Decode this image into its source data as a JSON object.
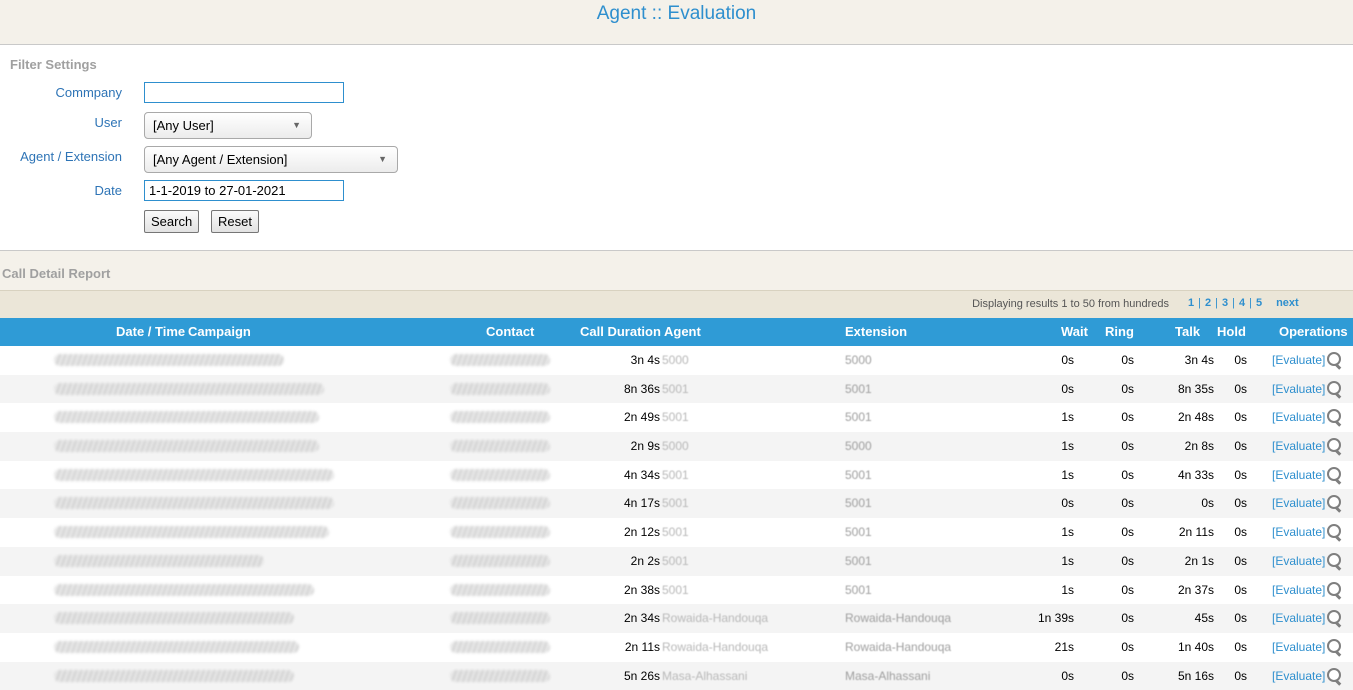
{
  "title": "Agent :: Evaluation",
  "filter": {
    "heading": "Filter Settings",
    "company_label": "Commpany",
    "company_value": "",
    "user_label": "User",
    "user_selected": "[Any User]",
    "agent_label": "Agent / Extension",
    "agent_selected": "[Any Agent / Extension]",
    "date_label": "Date",
    "date_value": "1-1-2019 to 27-01-2021",
    "search_label": "Search",
    "reset_label": "Reset"
  },
  "report": {
    "heading": "Call Detail Report",
    "pager_text": "Displaying results 1 to 50 from hundreds",
    "pages": [
      "1",
      "2",
      "3",
      "4",
      "5"
    ],
    "next_label": "next",
    "columns": {
      "datetime": "Date / Time",
      "campaign": "Campaign",
      "contact": "Contact",
      "duration": "Call Duration",
      "agent": "Agent",
      "extension": "Extension",
      "wait": "Wait",
      "ring": "Ring",
      "talk": "Talk",
      "hold": "Hold",
      "operations": "Operations"
    },
    "evaluate_label": "[Evaluate]",
    "rows": [
      {
        "duration": "3n 4s",
        "agent": "5000",
        "extension": "5000",
        "wait": "0s",
        "ring": "0s",
        "talk": "3n 4s",
        "hold": "0s"
      },
      {
        "duration": "8n 36s",
        "agent": "5001",
        "extension": "5001",
        "wait": "0s",
        "ring": "0s",
        "talk": "8n 35s",
        "hold": "0s"
      },
      {
        "duration": "2n 49s",
        "agent": "5001",
        "extension": "5001",
        "wait": "1s",
        "ring": "0s",
        "talk": "2n 48s",
        "hold": "0s"
      },
      {
        "duration": "2n 9s",
        "agent": "5000",
        "extension": "5000",
        "wait": "1s",
        "ring": "0s",
        "talk": "2n 8s",
        "hold": "0s"
      },
      {
        "duration": "4n 34s",
        "agent": "5001",
        "extension": "5001",
        "wait": "1s",
        "ring": "0s",
        "talk": "4n 33s",
        "hold": "0s"
      },
      {
        "duration": "4n 17s",
        "agent": "5001",
        "extension": "5001",
        "wait": "0s",
        "ring": "0s",
        "talk": "0s",
        "hold": "0s"
      },
      {
        "duration": "2n 12s",
        "agent": "5001",
        "extension": "5001",
        "wait": "1s",
        "ring": "0s",
        "talk": "2n 11s",
        "hold": "0s"
      },
      {
        "duration": "2n 2s",
        "agent": "5001",
        "extension": "5001",
        "wait": "1s",
        "ring": "0s",
        "talk": "2n 1s",
        "hold": "0s"
      },
      {
        "duration": "2n 38s",
        "agent": "5001",
        "extension": "5001",
        "wait": "1s",
        "ring": "0s",
        "talk": "2n 37s",
        "hold": "0s"
      },
      {
        "duration": "2n 34s",
        "agent": "Rowaida-Handouqa",
        "extension": "Rowaida-Handouqa",
        "wait": "1n 39s",
        "ring": "0s",
        "talk": "45s",
        "hold": "0s"
      },
      {
        "duration": "2n 11s",
        "agent": "Rowaida-Handouqa",
        "extension": "Rowaida-Handouqa",
        "wait": "21s",
        "ring": "0s",
        "talk": "1n 40s",
        "hold": "0s"
      },
      {
        "duration": "5n 26s",
        "agent": "Masa-Alhassani",
        "extension": "Masa-Alhassani",
        "wait": "0s",
        "ring": "0s",
        "talk": "5n 16s",
        "hold": "0s"
      }
    ]
  },
  "colors": {
    "accent": "#2e8fce",
    "header_bg": "#2f9bd6",
    "page_bg": "#f4f1ea"
  }
}
